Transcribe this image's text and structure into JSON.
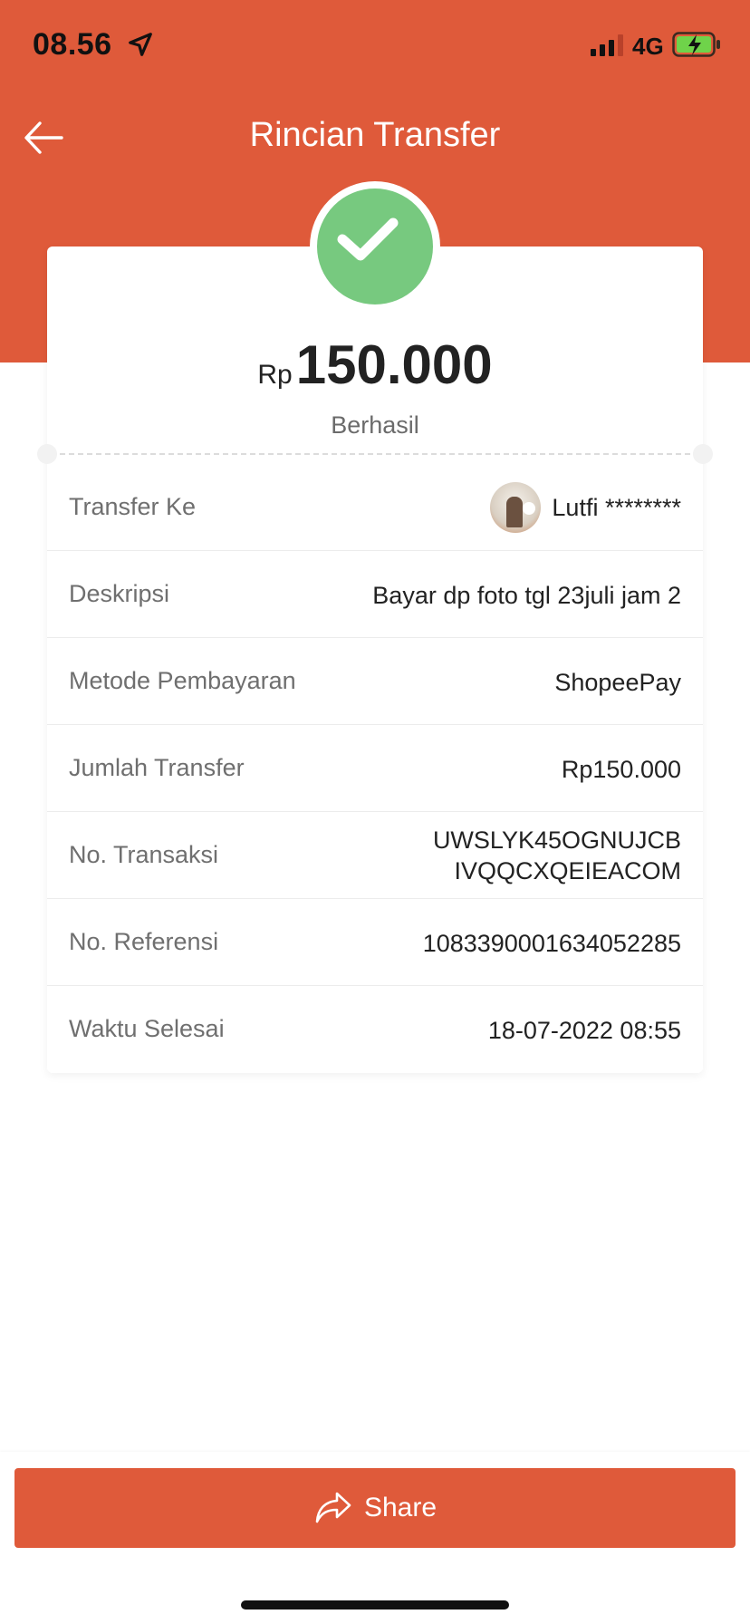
{
  "status_bar": {
    "time": "08.56",
    "network": "4G"
  },
  "header": {
    "title": "Rincian Transfer"
  },
  "summary": {
    "currency": "Rp",
    "amount": "150.000",
    "status": "Berhasil"
  },
  "details": [
    {
      "label": "Transfer Ke",
      "value": "Lutfi ********"
    },
    {
      "label": "Deskripsi",
      "value": "Bayar dp foto tgl 23juli jam 2"
    },
    {
      "label": "Metode Pembayaran",
      "value": "ShopeePay"
    },
    {
      "label": "Jumlah Transfer",
      "value": "Rp150.000"
    },
    {
      "label": "No. Transaksi",
      "value_line1": "UWSLYK45OGNUJCB",
      "value_line2": "IVQQCXQEIEACOM"
    },
    {
      "label": "No. Referensi",
      "value": "1083390001634052285"
    },
    {
      "label": "Waktu Selesai",
      "value": "18-07-2022 08:55"
    }
  ],
  "footer": {
    "share_label": "Share"
  },
  "colors": {
    "brand": "#DF5A3A",
    "success": "#77C97F"
  },
  "icons": [
    "location-arrow-icon",
    "signal-icon",
    "battery-charging-icon",
    "back-arrow-icon",
    "checkmark-icon",
    "share-icon"
  ]
}
